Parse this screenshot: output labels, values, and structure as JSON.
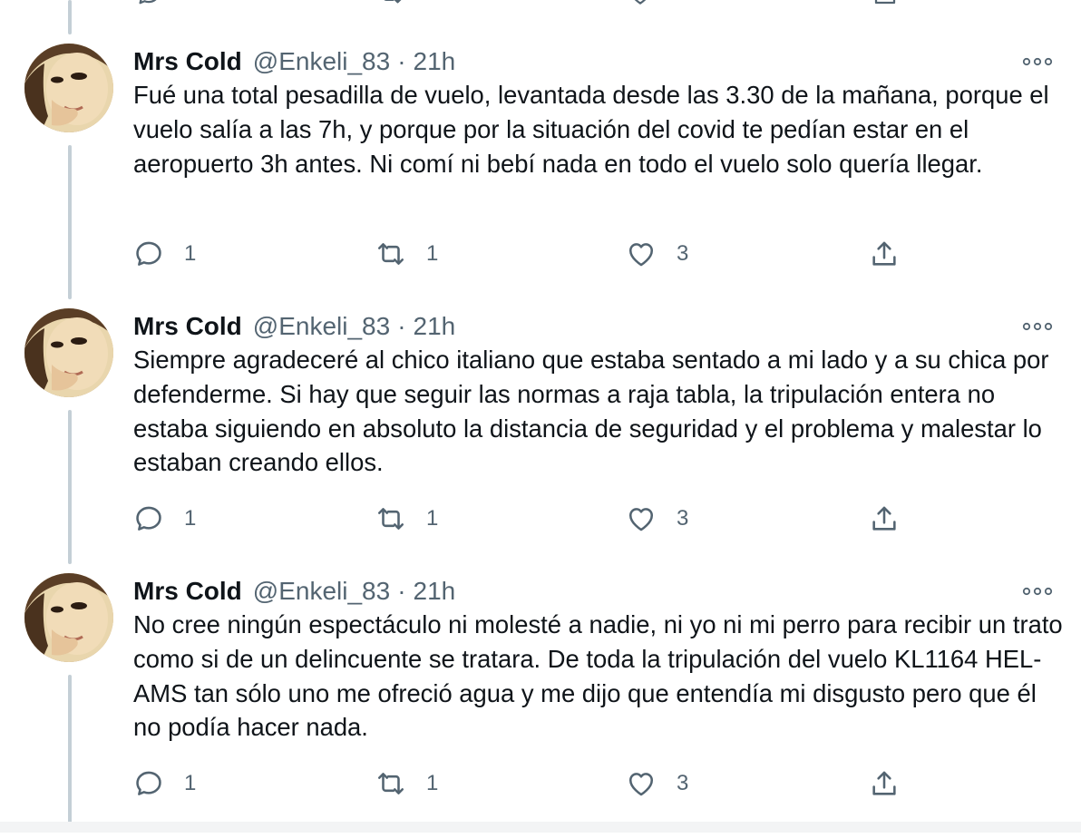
{
  "colors": {
    "text": "#0f1419",
    "secondary": "#536471",
    "thread_line": "#c4cfd6",
    "background": "#ffffff"
  },
  "icons": {
    "reply": "speech-bubble-icon",
    "retweet": "retweet-arrows-icon",
    "like": "heart-icon",
    "share": "share-upload-icon",
    "more": "more-dots-icon"
  },
  "tweets": [
    {
      "name": "Mrs Cold",
      "handle": "@Enkeli_83",
      "separator": "·",
      "time": "21h",
      "text": "Fué una total pesadilla de vuelo, levantada desde las 3.30 de la mañana, porque el vuelo salía a las 7h, y porque por la situación del covid te pedían estar en el aeropuerto 3h antes. Ni comí ni bebí nada en todo el vuelo solo quería llegar.",
      "replies": "1",
      "retweets": "1",
      "likes": "3"
    },
    {
      "name": "Mrs Cold",
      "handle": "@Enkeli_83",
      "separator": "·",
      "time": "21h",
      "text": "Siempre agradeceré al chico italiano que estaba sentado a mi lado y a su chica por defenderme. Si hay que seguir las normas a raja tabla, la tripulación entera no estaba siguiendo en absoluto la distancia de seguridad y el problema y malestar lo estaban creando ellos.",
      "replies": "1",
      "retweets": "1",
      "likes": "3"
    },
    {
      "name": "Mrs Cold",
      "handle": "@Enkeli_83",
      "separator": "·",
      "time": "21h",
      "text": "No cree ningún espectáculo ni molesté a nadie, ni yo ni mi perro para recibir un trato como si de un delincuente se tratara. De toda la tripulación del vuelo KL1164 HEL-AMS tan sólo uno me ofreció agua y me dijo que entendía mi disgusto pero que él no podía hacer nada.",
      "replies": "1",
      "retweets": "1",
      "likes": "3"
    }
  ]
}
